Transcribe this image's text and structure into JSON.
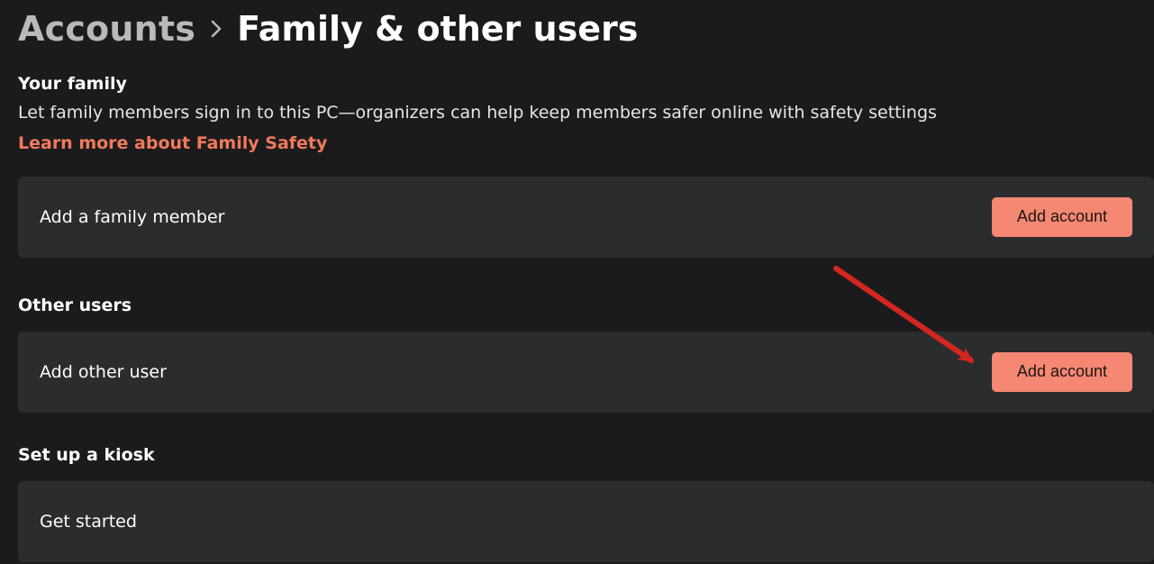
{
  "breadcrumb": {
    "parent": "Accounts",
    "current": "Family & other users"
  },
  "sections": {
    "family": {
      "title": "Your family",
      "description": "Let family members sign in to this PC—organizers can help keep members safer online with safety settings",
      "learn_more": "Learn more about Family Safety",
      "card_label": "Add a family member",
      "card_button": "Add account"
    },
    "other": {
      "title": "Other users",
      "card_label": "Add other user",
      "card_button": "Add account"
    },
    "kiosk": {
      "title": "Set up a kiosk",
      "card_label": "Get started"
    }
  },
  "colors": {
    "accent": "#f58873",
    "link": "#f07a5c",
    "bg": "#1b1b1d",
    "card": "#2b2c2e",
    "annotation": "#d3261f"
  }
}
